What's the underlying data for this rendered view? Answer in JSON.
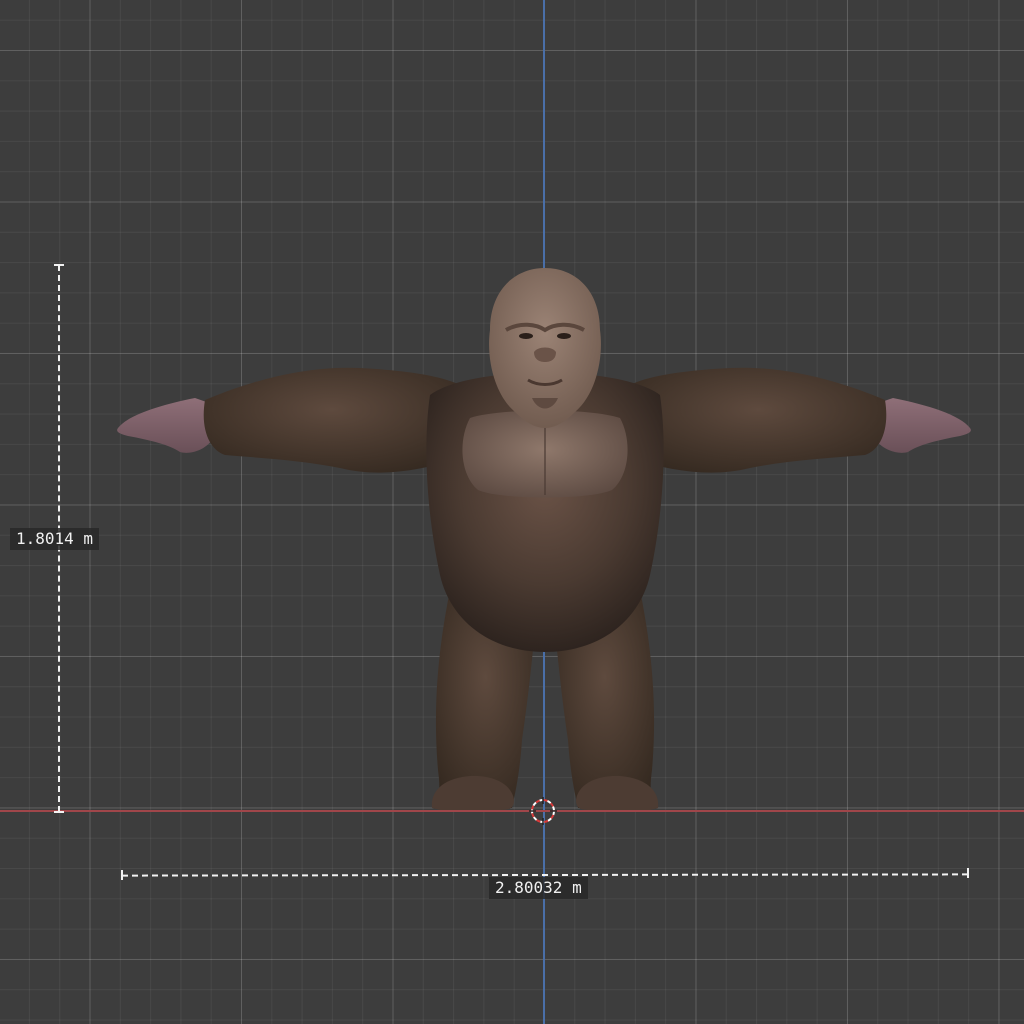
{
  "viewport": {
    "view": "front orthographic",
    "grid": true,
    "colors": {
      "background": "#3d3d3d",
      "x_axis": "#a0464a",
      "z_axis": "#4a6fa8",
      "measure_line": "#f2f2f2"
    }
  },
  "object": {
    "subject": "gorilla character model in T-pose"
  },
  "measurements": {
    "height_label": "1.8014 m",
    "width_label": "2.80032 m"
  },
  "cursor": {
    "icon": "3d-cursor-icon"
  }
}
